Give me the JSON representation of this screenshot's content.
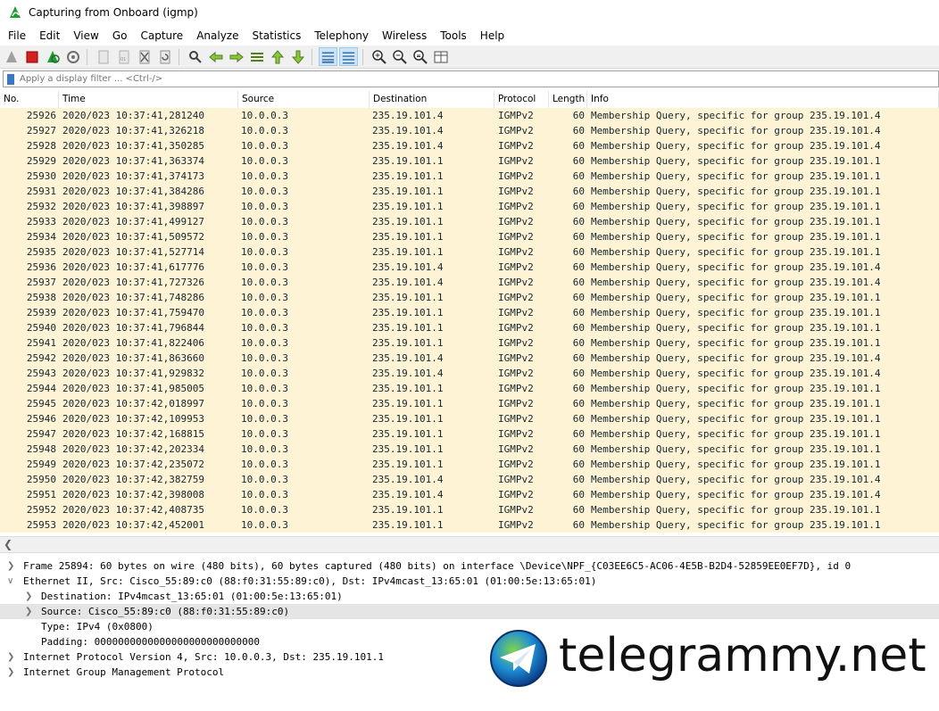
{
  "window": {
    "title": "Capturing from Onboard (igmp)"
  },
  "menu": [
    "File",
    "Edit",
    "View",
    "Go",
    "Capture",
    "Analyze",
    "Statistics",
    "Telephony",
    "Wireless",
    "Tools",
    "Help"
  ],
  "toolbar": {
    "icons": [
      "shark-fin-start-icon",
      "stop-capture-icon",
      "restart-capture-icon",
      "capture-options-icon",
      "open-file-icon",
      "save-file-icon",
      "close-file-icon",
      "reload-file-icon",
      "find-packet-icon",
      "go-back-icon",
      "go-forward-icon",
      "go-to-packet-icon",
      "first-packet-icon",
      "last-packet-icon",
      "auto-scroll-icon",
      "colorize-icon",
      "zoom-in-icon",
      "zoom-out-icon",
      "normal-size-icon",
      "resize-columns-icon"
    ]
  },
  "filter": {
    "placeholder": "Apply a display filter ... <Ctrl-/>"
  },
  "columns": [
    "No.",
    "Time",
    "Source",
    "Destination",
    "Protocol",
    "Length",
    "Info"
  ],
  "packets": [
    [
      "25926",
      "2020/023 10:37:41,281240",
      "10.0.0.3",
      "235.19.101.4",
      "IGMPv2",
      "60",
      "Membership Query, specific for group 235.19.101.4"
    ],
    [
      "25927",
      "2020/023 10:37:41,326218",
      "10.0.0.3",
      "235.19.101.4",
      "IGMPv2",
      "60",
      "Membership Query, specific for group 235.19.101.4"
    ],
    [
      "25928",
      "2020/023 10:37:41,350285",
      "10.0.0.3",
      "235.19.101.4",
      "IGMPv2",
      "60",
      "Membership Query, specific for group 235.19.101.4"
    ],
    [
      "25929",
      "2020/023 10:37:41,363374",
      "10.0.0.3",
      "235.19.101.1",
      "IGMPv2",
      "60",
      "Membership Query, specific for group 235.19.101.1"
    ],
    [
      "25930",
      "2020/023 10:37:41,374173",
      "10.0.0.3",
      "235.19.101.1",
      "IGMPv2",
      "60",
      "Membership Query, specific for group 235.19.101.1"
    ],
    [
      "25931",
      "2020/023 10:37:41,384286",
      "10.0.0.3",
      "235.19.101.1",
      "IGMPv2",
      "60",
      "Membership Query, specific for group 235.19.101.1"
    ],
    [
      "25932",
      "2020/023 10:37:41,398897",
      "10.0.0.3",
      "235.19.101.1",
      "IGMPv2",
      "60",
      "Membership Query, specific for group 235.19.101.1"
    ],
    [
      "25933",
      "2020/023 10:37:41,499127",
      "10.0.0.3",
      "235.19.101.1",
      "IGMPv2",
      "60",
      "Membership Query, specific for group 235.19.101.1"
    ],
    [
      "25934",
      "2020/023 10:37:41,509572",
      "10.0.0.3",
      "235.19.101.1",
      "IGMPv2",
      "60",
      "Membership Query, specific for group 235.19.101.1"
    ],
    [
      "25935",
      "2020/023 10:37:41,527714",
      "10.0.0.3",
      "235.19.101.1",
      "IGMPv2",
      "60",
      "Membership Query, specific for group 235.19.101.1"
    ],
    [
      "25936",
      "2020/023 10:37:41,617776",
      "10.0.0.3",
      "235.19.101.4",
      "IGMPv2",
      "60",
      "Membership Query, specific for group 235.19.101.4"
    ],
    [
      "25937",
      "2020/023 10:37:41,727326",
      "10.0.0.3",
      "235.19.101.4",
      "IGMPv2",
      "60",
      "Membership Query, specific for group 235.19.101.4"
    ],
    [
      "25938",
      "2020/023 10:37:41,748286",
      "10.0.0.3",
      "235.19.101.1",
      "IGMPv2",
      "60",
      "Membership Query, specific for group 235.19.101.1"
    ],
    [
      "25939",
      "2020/023 10:37:41,759470",
      "10.0.0.3",
      "235.19.101.1",
      "IGMPv2",
      "60",
      "Membership Query, specific for group 235.19.101.1"
    ],
    [
      "25940",
      "2020/023 10:37:41,796844",
      "10.0.0.3",
      "235.19.101.1",
      "IGMPv2",
      "60",
      "Membership Query, specific for group 235.19.101.1"
    ],
    [
      "25941",
      "2020/023 10:37:41,822406",
      "10.0.0.3",
      "235.19.101.1",
      "IGMPv2",
      "60",
      "Membership Query, specific for group 235.19.101.1"
    ],
    [
      "25942",
      "2020/023 10:37:41,863660",
      "10.0.0.3",
      "235.19.101.4",
      "IGMPv2",
      "60",
      "Membership Query, specific for group 235.19.101.4"
    ],
    [
      "25943",
      "2020/023 10:37:41,929832",
      "10.0.0.3",
      "235.19.101.4",
      "IGMPv2",
      "60",
      "Membership Query, specific for group 235.19.101.4"
    ],
    [
      "25944",
      "2020/023 10:37:41,985005",
      "10.0.0.3",
      "235.19.101.1",
      "IGMPv2",
      "60",
      "Membership Query, specific for group 235.19.101.1"
    ],
    [
      "25945",
      "2020/023 10:37:42,018997",
      "10.0.0.3",
      "235.19.101.1",
      "IGMPv2",
      "60",
      "Membership Query, specific for group 235.19.101.1"
    ],
    [
      "25946",
      "2020/023 10:37:42,109953",
      "10.0.0.3",
      "235.19.101.1",
      "IGMPv2",
      "60",
      "Membership Query, specific for group 235.19.101.1"
    ],
    [
      "25947",
      "2020/023 10:37:42,168815",
      "10.0.0.3",
      "235.19.101.1",
      "IGMPv2",
      "60",
      "Membership Query, specific for group 235.19.101.1"
    ],
    [
      "25948",
      "2020/023 10:37:42,202334",
      "10.0.0.3",
      "235.19.101.1",
      "IGMPv2",
      "60",
      "Membership Query, specific for group 235.19.101.1"
    ],
    [
      "25949",
      "2020/023 10:37:42,235072",
      "10.0.0.3",
      "235.19.101.1",
      "IGMPv2",
      "60",
      "Membership Query, specific for group 235.19.101.1"
    ],
    [
      "25950",
      "2020/023 10:37:42,382759",
      "10.0.0.3",
      "235.19.101.4",
      "IGMPv2",
      "60",
      "Membership Query, specific for group 235.19.101.4"
    ],
    [
      "25951",
      "2020/023 10:37:42,398008",
      "10.0.0.3",
      "235.19.101.4",
      "IGMPv2",
      "60",
      "Membership Query, specific for group 235.19.101.4"
    ],
    [
      "25952",
      "2020/023 10:37:42,408735",
      "10.0.0.3",
      "235.19.101.1",
      "IGMPv2",
      "60",
      "Membership Query, specific for group 235.19.101.1"
    ],
    [
      "25953",
      "2020/023 10:37:42,452001",
      "10.0.0.3",
      "235.19.101.1",
      "IGMPv2",
      "60",
      "Membership Query, specific for group 235.19.101.1"
    ]
  ],
  "details": [
    {
      "indent": 0,
      "expander": "collapsed",
      "text": "Frame 25894: 60 bytes on wire (480 bits), 60 bytes captured (480 bits) on interface \\Device\\NPF_{C03EE6C5-AC06-4E5B-B2D4-52859EE0EF7D}, id 0",
      "selected": false
    },
    {
      "indent": 0,
      "expander": "expanded",
      "text": "Ethernet II, Src: Cisco_55:89:c0 (88:f0:31:55:89:c0), Dst: IPv4mcast_13:65:01 (01:00:5e:13:65:01)",
      "selected": false
    },
    {
      "indent": 1,
      "expander": "collapsed",
      "text": "Destination: IPv4mcast_13:65:01 (01:00:5e:13:65:01)",
      "selected": false
    },
    {
      "indent": 1,
      "expander": "collapsed",
      "text": "Source: Cisco_55:89:c0 (88:f0:31:55:89:c0)",
      "selected": true
    },
    {
      "indent": 1,
      "expander": "none",
      "text": "Type: IPv4 (0x0800)",
      "selected": false
    },
    {
      "indent": 1,
      "expander": "none",
      "text": "Padding: 0000000000000000000000000000",
      "selected": false
    },
    {
      "indent": 0,
      "expander": "collapsed",
      "text": "Internet Protocol Version 4, Src: 10.0.0.3, Dst: 235.19.101.1",
      "selected": false
    },
    {
      "indent": 0,
      "expander": "collapsed",
      "text": "Internet Group Management Protocol",
      "selected": false
    }
  ],
  "watermark": {
    "text": "telegrammy.net"
  },
  "colors": {
    "row_bg": "#fff3d6",
    "selected_detail_bg": "#e5e5e5",
    "wireshark_green": "#1d9e34",
    "stop_red": "#d62020"
  }
}
